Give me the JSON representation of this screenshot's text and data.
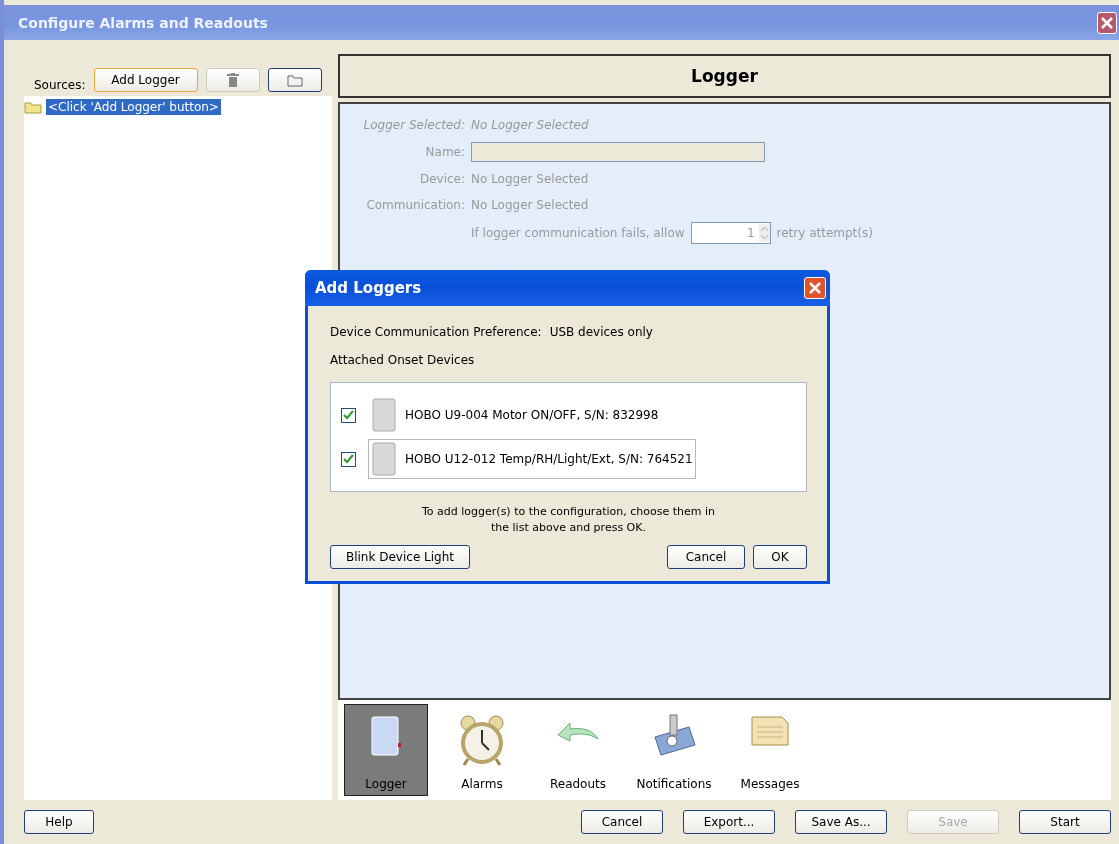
{
  "window": {
    "title": "Configure Alarms and Readouts"
  },
  "sources": {
    "label": "Sources:",
    "add_button": "Add Logger",
    "items": [
      {
        "label": "<Click 'Add Logger' button>",
        "selected": true
      }
    ]
  },
  "panel": {
    "title": "Logger",
    "fields": [
      {
        "kind": "italic",
        "label": "Logger Selected:",
        "value": "No Logger Selected"
      },
      {
        "kind": "input",
        "label": "Name:"
      },
      {
        "kind": "text",
        "label": "Device:",
        "value": "No Logger Selected"
      },
      {
        "kind": "text",
        "label": "Communication:",
        "value": "No Logger Selected"
      }
    ],
    "retry": {
      "prefix": "If logger communication fails, allow",
      "value": "1",
      "suffix": "retry attempt(s)"
    }
  },
  "tabs": [
    {
      "kind": "logger",
      "label": "Logger",
      "selected": true
    },
    {
      "kind": "clock",
      "label": "Alarms",
      "selected": false
    },
    {
      "kind": "arrow",
      "label": "Readouts",
      "selected": false
    },
    {
      "kind": "envelope",
      "label": "Notifications",
      "selected": false
    },
    {
      "kind": "note",
      "label": "Messages",
      "selected": false
    }
  ],
  "help_button": "Help",
  "buttons": [
    {
      "label": "Cancel",
      "disabled": false
    },
    {
      "label": "Export...",
      "disabled": false
    },
    {
      "label": "Save As...",
      "disabled": false
    },
    {
      "label": "Save",
      "disabled": true
    },
    {
      "label": "Start",
      "disabled": false
    }
  ],
  "dialog": {
    "title": "Add Loggers",
    "preference_label": "Device Communication Preference:",
    "preference_value": "USB devices only",
    "attached_label": "Attached Onset Devices",
    "devices": [
      {
        "label": "HOBO U9-004 Motor ON/OFF, S/N: 832998",
        "checked": true,
        "focused": false
      },
      {
        "label": "HOBO U12-012 Temp/RH/Light/Ext, S/N: 764521",
        "checked": true,
        "focused": true
      }
    ],
    "hint": "To add logger(s) to the configuration, choose them in the list above and press OK.",
    "blink_button": "Blink Device Light",
    "buttons": [
      "Cancel",
      "OK"
    ]
  }
}
